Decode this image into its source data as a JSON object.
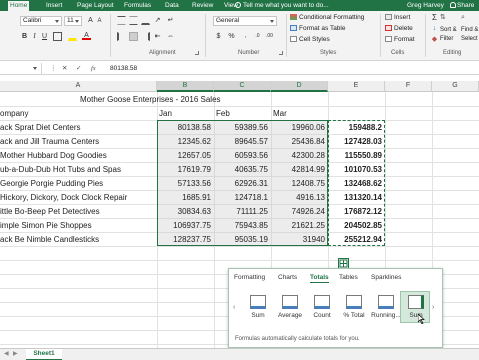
{
  "ribbon_tabs": [
    "Home",
    "Insert",
    "Page Layout",
    "Formulas",
    "Data",
    "Review",
    "View"
  ],
  "tell_me": "Tell me what you want to do...",
  "user": "Greg Harvey",
  "share": "Share",
  "font": {
    "name": "Calibri",
    "size": "11"
  },
  "number_format": "General",
  "groups": {
    "alignment": "Alignment",
    "number": "Number",
    "styles": "Styles",
    "cells": "Cells",
    "editing": "Editing"
  },
  "styles_cmds": [
    "Conditional Formatting",
    "Format as Table",
    "Cell Styles"
  ],
  "cells_cmds": [
    "Insert",
    "Delete",
    "Format"
  ],
  "editing_cmds": [
    "Sort &",
    "Filter",
    "Find &",
    "Select"
  ],
  "formula_bar": {
    "value": "80138.58",
    "fx": "fx"
  },
  "columns": [
    "A",
    "B",
    "C",
    "D",
    "E",
    "F",
    "G"
  ],
  "sheet": {
    "title": "Mother Goose Enterprises - 2016 Sales",
    "headers": {
      "company": "ompany",
      "jan": "Jan",
      "feb": "Feb",
      "mar": "Mar"
    },
    "rows": [
      {
        "name": "ack Sprat Diet Centers",
        "jan": "80138.58",
        "feb": "59389.56",
        "mar": "19960.06",
        "total": "159488.2"
      },
      {
        "name": "ack and Jill Trauma Centers",
        "jan": "12345.62",
        "feb": "89645.57",
        "mar": "25436.84",
        "total": "127428.03"
      },
      {
        "name": "Mother Hubbard Dog Goodies",
        "jan": "12657.05",
        "feb": "60593.56",
        "mar": "42300.28",
        "total": "115550.89"
      },
      {
        "name": "ub-a-Dub-Dub Hot Tubs and Spas",
        "jan": "17619.79",
        "feb": "40635.75",
        "mar": "42814.99",
        "total": "101070.53"
      },
      {
        "name": "Georgie Porgie Pudding Pies",
        "jan": "57133.56",
        "feb": "62926.31",
        "mar": "12408.75",
        "total": "132468.62"
      },
      {
        "name": "Hickory, Dickory,  Dock Clock Repair",
        "jan": "1685.91",
        "feb": "124718.1",
        "mar": "4916.13",
        "total": "131320.14"
      },
      {
        "name": "ittle Bo-Beep Pet Detectives",
        "jan": "30834.63",
        "feb": "71111.25",
        "mar": "74926.24",
        "total": "176872.12"
      },
      {
        "name": "imple Simon Pie Shoppes",
        "jan": "106937.75",
        "feb": "75943.85",
        "mar": "21621.25",
        "total": "204502.85"
      },
      {
        "name": "ack Be Nimble Candlesticks",
        "jan": "128237.75",
        "feb": "95035.19",
        "mar": "31940",
        "total": "255212.94"
      }
    ]
  },
  "quick_analysis": {
    "tabs": [
      "Formatting",
      "Charts",
      "Totals",
      "Tables",
      "Sparklines"
    ],
    "active_tab": "Totals",
    "options": [
      "Sum",
      "Average",
      "Count",
      "% Total",
      "Running...",
      "Sum"
    ],
    "hovered_option": "Sum",
    "note": "Formulas automatically calculate totals for you."
  },
  "sheet_tab": "Sheet1",
  "colors": {
    "excel_green": "#217346",
    "ribbon_bg": "#f3f3f3",
    "hover_green": "#d5e8dc"
  }
}
